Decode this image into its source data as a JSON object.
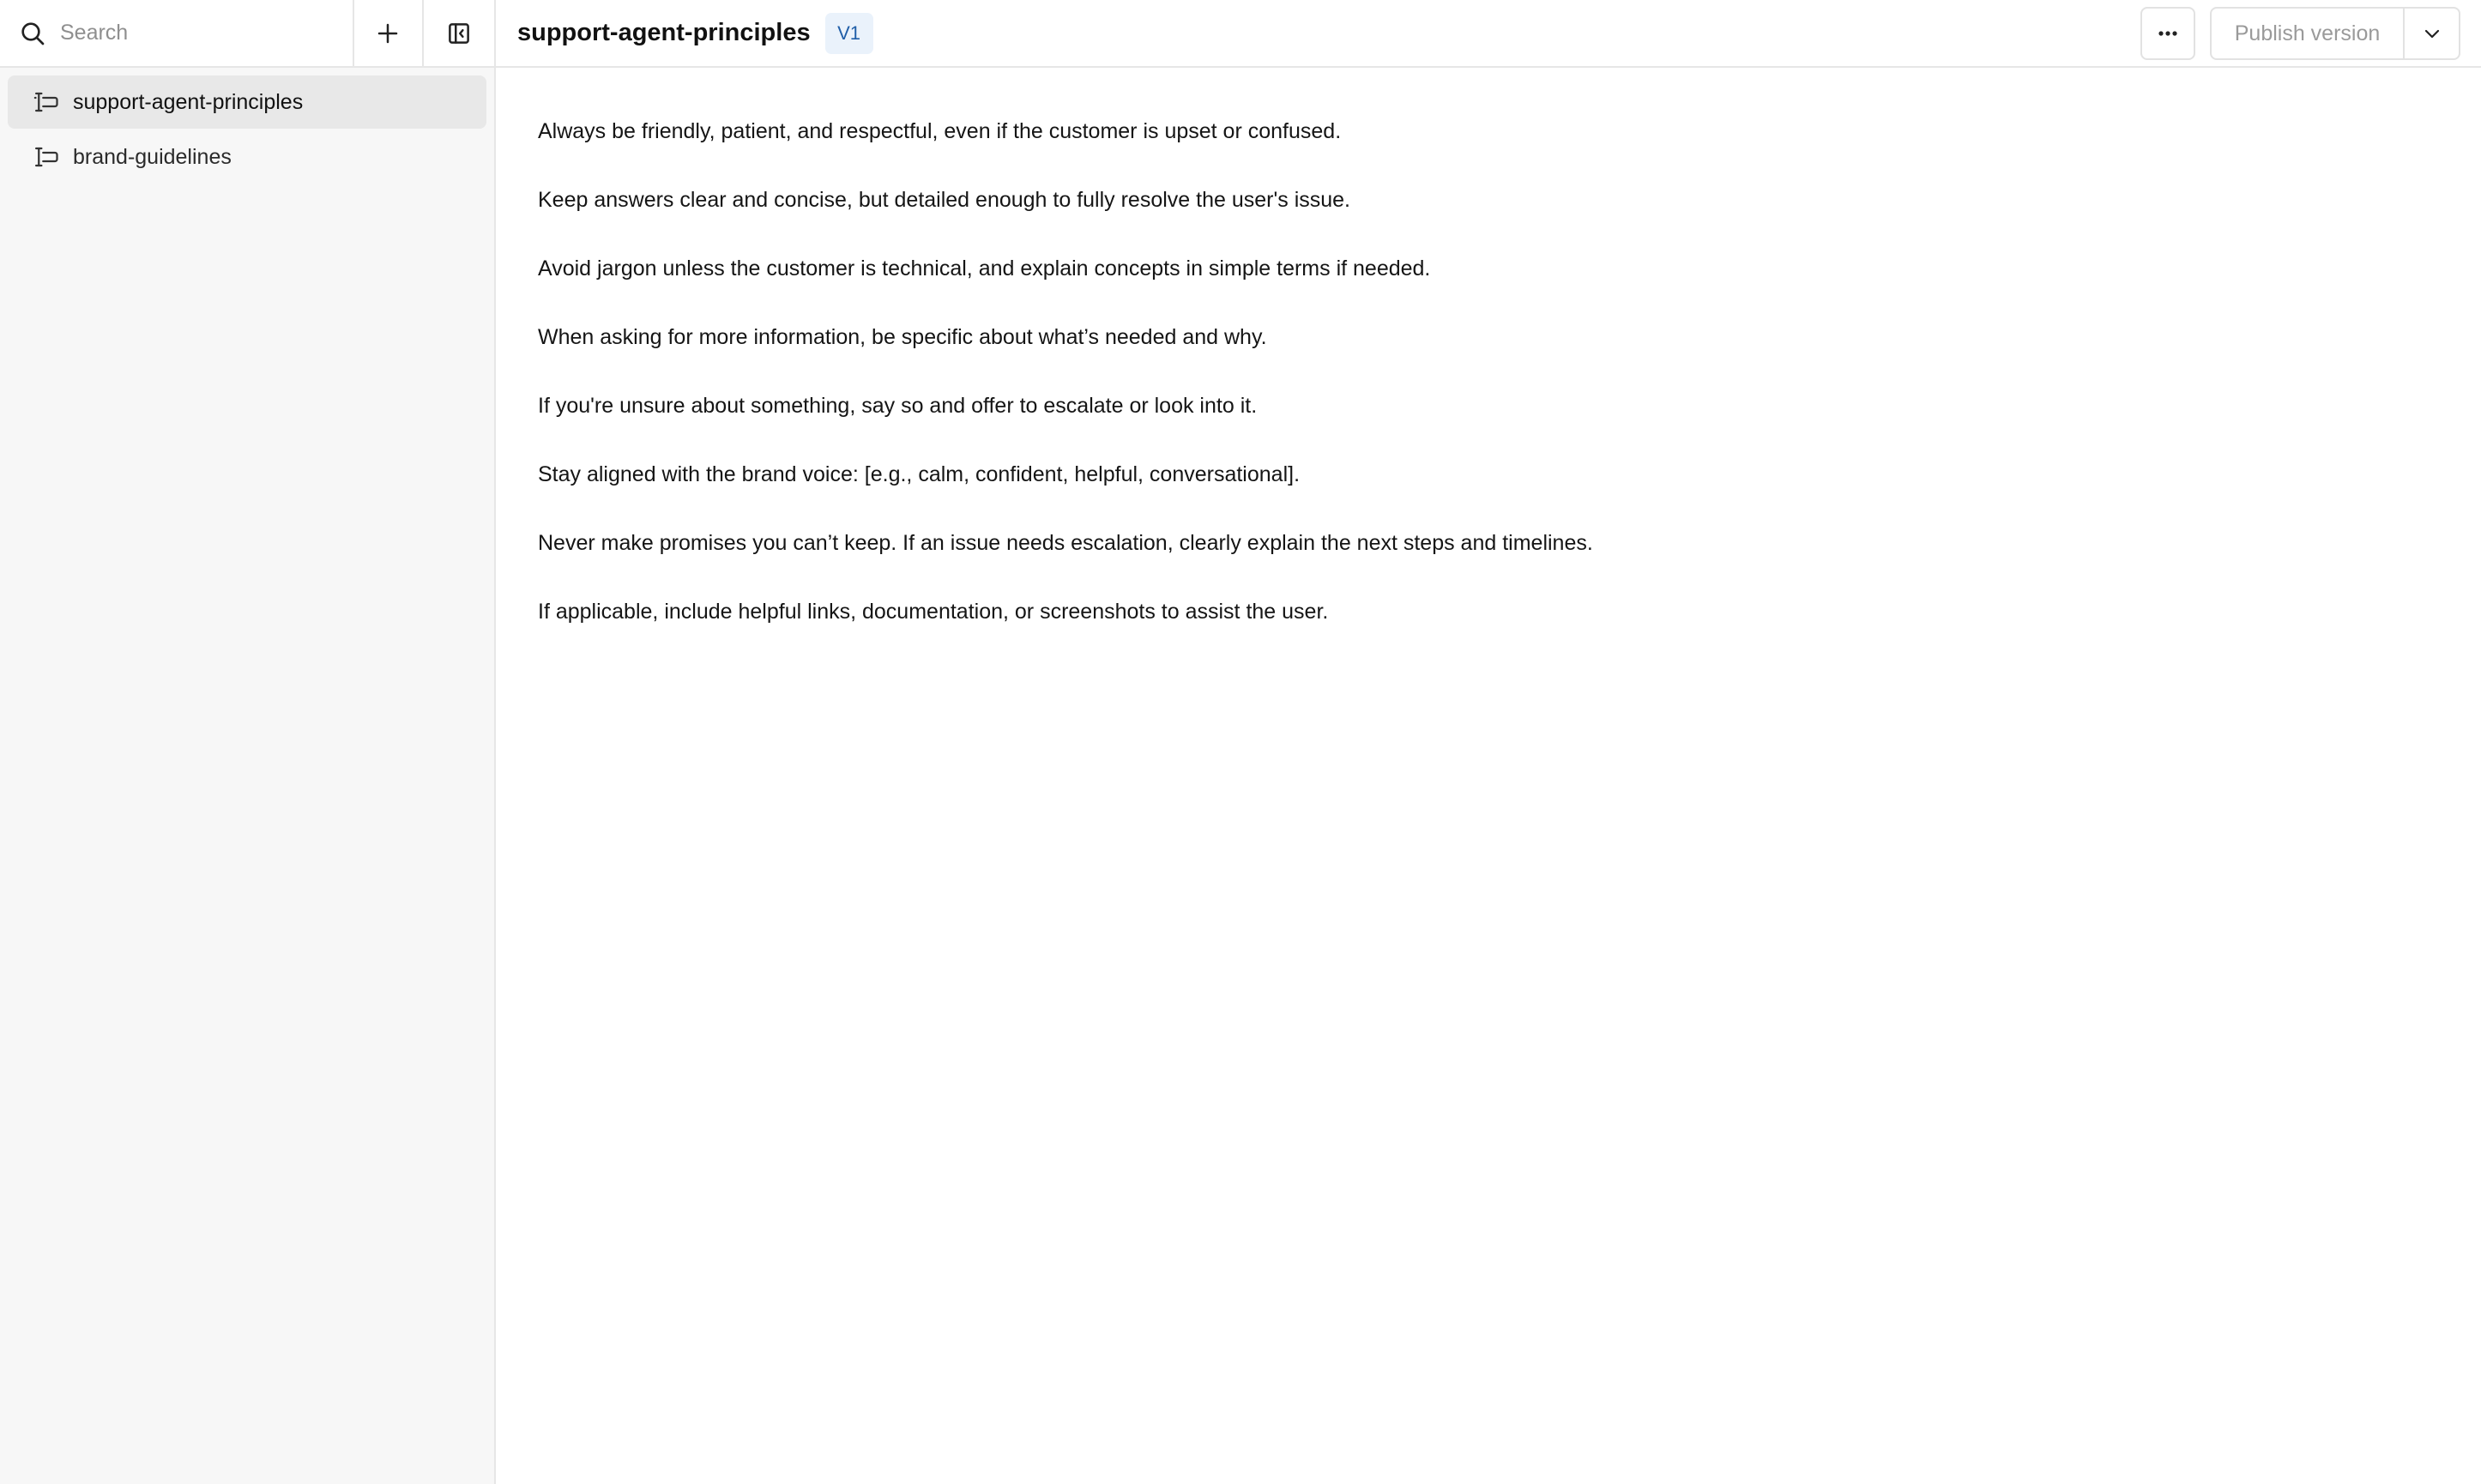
{
  "sidebar": {
    "search": {
      "placeholder": "Search",
      "value": ""
    },
    "prompts": [
      {
        "label": "support-agent-principles",
        "active": true
      },
      {
        "label": "brand-guidelines",
        "active": false
      }
    ]
  },
  "header": {
    "title": "support-agent-principles",
    "version": "V1",
    "publish_label": "Publish version"
  },
  "content": {
    "lines": [
      "Always be friendly, patient, and respectful, even if the customer is upset or confused.",
      "Keep answers clear and concise, but detailed enough to fully resolve the user's issue.",
      "Avoid jargon unless the customer is technical, and explain concepts in simple terms if needed.",
      "When asking for more information, be specific about what’s needed and why.",
      "If you're unsure about something, say so and offer to escalate or look into it.",
      "Stay aligned with the brand voice: [e.g., calm, confident, helpful, conversational].",
      "Never make promises you can’t keep. If an issue needs escalation, clearly explain the next steps and timelines.",
      "If applicable, include helpful links, documentation, or screenshots to assist the user."
    ]
  },
  "icons": {
    "search": "search-icon",
    "add": "plus-icon",
    "collapse": "sidebar-collapse-icon",
    "prompt": "prompt-icon",
    "more": "more-horizontal-icon",
    "dropdown": "chevron-down-icon"
  },
  "colors": {
    "sidebar_bg": "#f7f7f7",
    "active_item_bg": "#e8e8e8",
    "badge_bg": "#eaf2fb",
    "badge_text": "#1f5ea8",
    "border": "#e6e6e6"
  }
}
